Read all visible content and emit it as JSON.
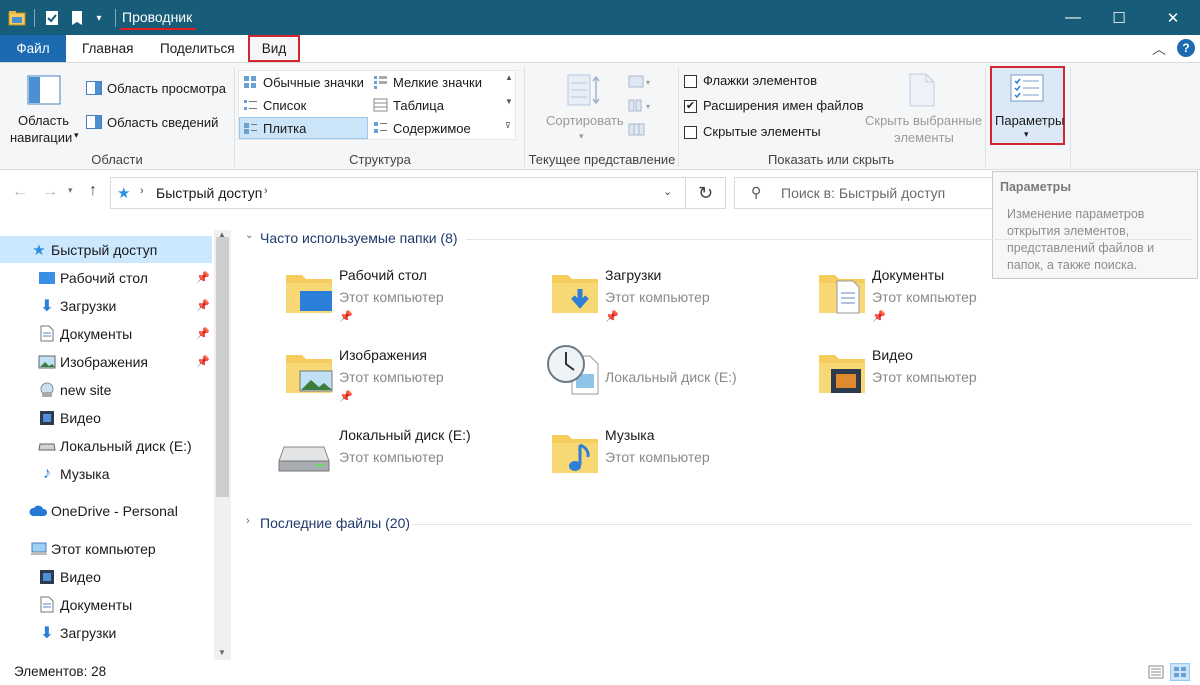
{
  "window": {
    "title": "Проводник",
    "minimize": "—",
    "maximize": "☐",
    "close": "✕"
  },
  "tabs": {
    "file": "Файл",
    "home": "Главная",
    "share": "Поделиться",
    "view": "Вид"
  },
  "ribbon": {
    "areas": {
      "nav_pane_line1": "Область",
      "nav_pane_line2": "навигации",
      "preview_pane": "Область просмотра",
      "details_pane": "Область сведений",
      "label": "Области"
    },
    "layout": {
      "large_icons": "Обычные значки",
      "small_icons": "Мелкие значки",
      "list": "Список",
      "table": "Таблица",
      "tiles": "Плитка",
      "content": "Содержимое",
      "label": "Структура"
    },
    "current_view": {
      "sort_by": "Сортировать",
      "label": "Текущее представление"
    },
    "show_hide": {
      "item_checkboxes": "Флажки элементов",
      "file_extensions": "Расширения имен файлов",
      "hidden_items": "Скрытые элементы",
      "hide_selected_line1": "Скрыть выбранные",
      "hide_selected_line2": "элементы",
      "label": "Показать или скрыть",
      "item_checkboxes_checked": false,
      "file_extensions_checked": true,
      "hidden_items_checked": false
    },
    "options": {
      "label": "Параметры"
    }
  },
  "address": {
    "path": "Быстрый доступ",
    "search_placeholder": "Поиск в: Быстрый доступ"
  },
  "tooltip": {
    "title": "Параметры",
    "line1": "Изменение параметров",
    "line2": "открытия элементов,",
    "line3": "представлений файлов и",
    "line4": "папок, а также поиска."
  },
  "sidebar": {
    "quick_access": "Быстрый доступ",
    "items": [
      {
        "label": "Рабочий стол"
      },
      {
        "label": "Загрузки"
      },
      {
        "label": "Документы"
      },
      {
        "label": "Изображения"
      },
      {
        "label": "new site"
      },
      {
        "label": "Видео"
      },
      {
        "label": "Локальный диск (E:)"
      },
      {
        "label": "Музыка"
      }
    ],
    "onedrive": "OneDrive - Personal",
    "this_pc": "Этот компьютер",
    "pc_items": [
      {
        "label": "Видео"
      },
      {
        "label": "Документы"
      },
      {
        "label": "Загрузки"
      }
    ]
  },
  "content": {
    "frequent_header": "Часто используемые папки (8)",
    "recent_header": "Последние файлы (20)",
    "tiles": [
      {
        "name": "Рабочий стол",
        "sub": "Этот компьютер"
      },
      {
        "name": "Загрузки",
        "sub": "Этот компьютер"
      },
      {
        "name": "Документы",
        "sub": "Этот компьютер"
      },
      {
        "name": "Изображения",
        "sub": "Этот компьютер"
      },
      {
        "name": "",
        "sub": "Локальный диск (E:)"
      },
      {
        "name": "Видео",
        "sub": "Этот компьютер"
      },
      {
        "name": "Локальный диск (E:)",
        "sub": "Этот компьютер"
      },
      {
        "name": "Музыка",
        "sub": "Этот компьютер"
      }
    ]
  },
  "status": {
    "items_count": "Элементов: 28"
  },
  "colors": {
    "titlebar": "#175d7a",
    "file_tab": "#1c6bb0",
    "highlight": "#d4262e",
    "folder": "#f6cd5d"
  }
}
